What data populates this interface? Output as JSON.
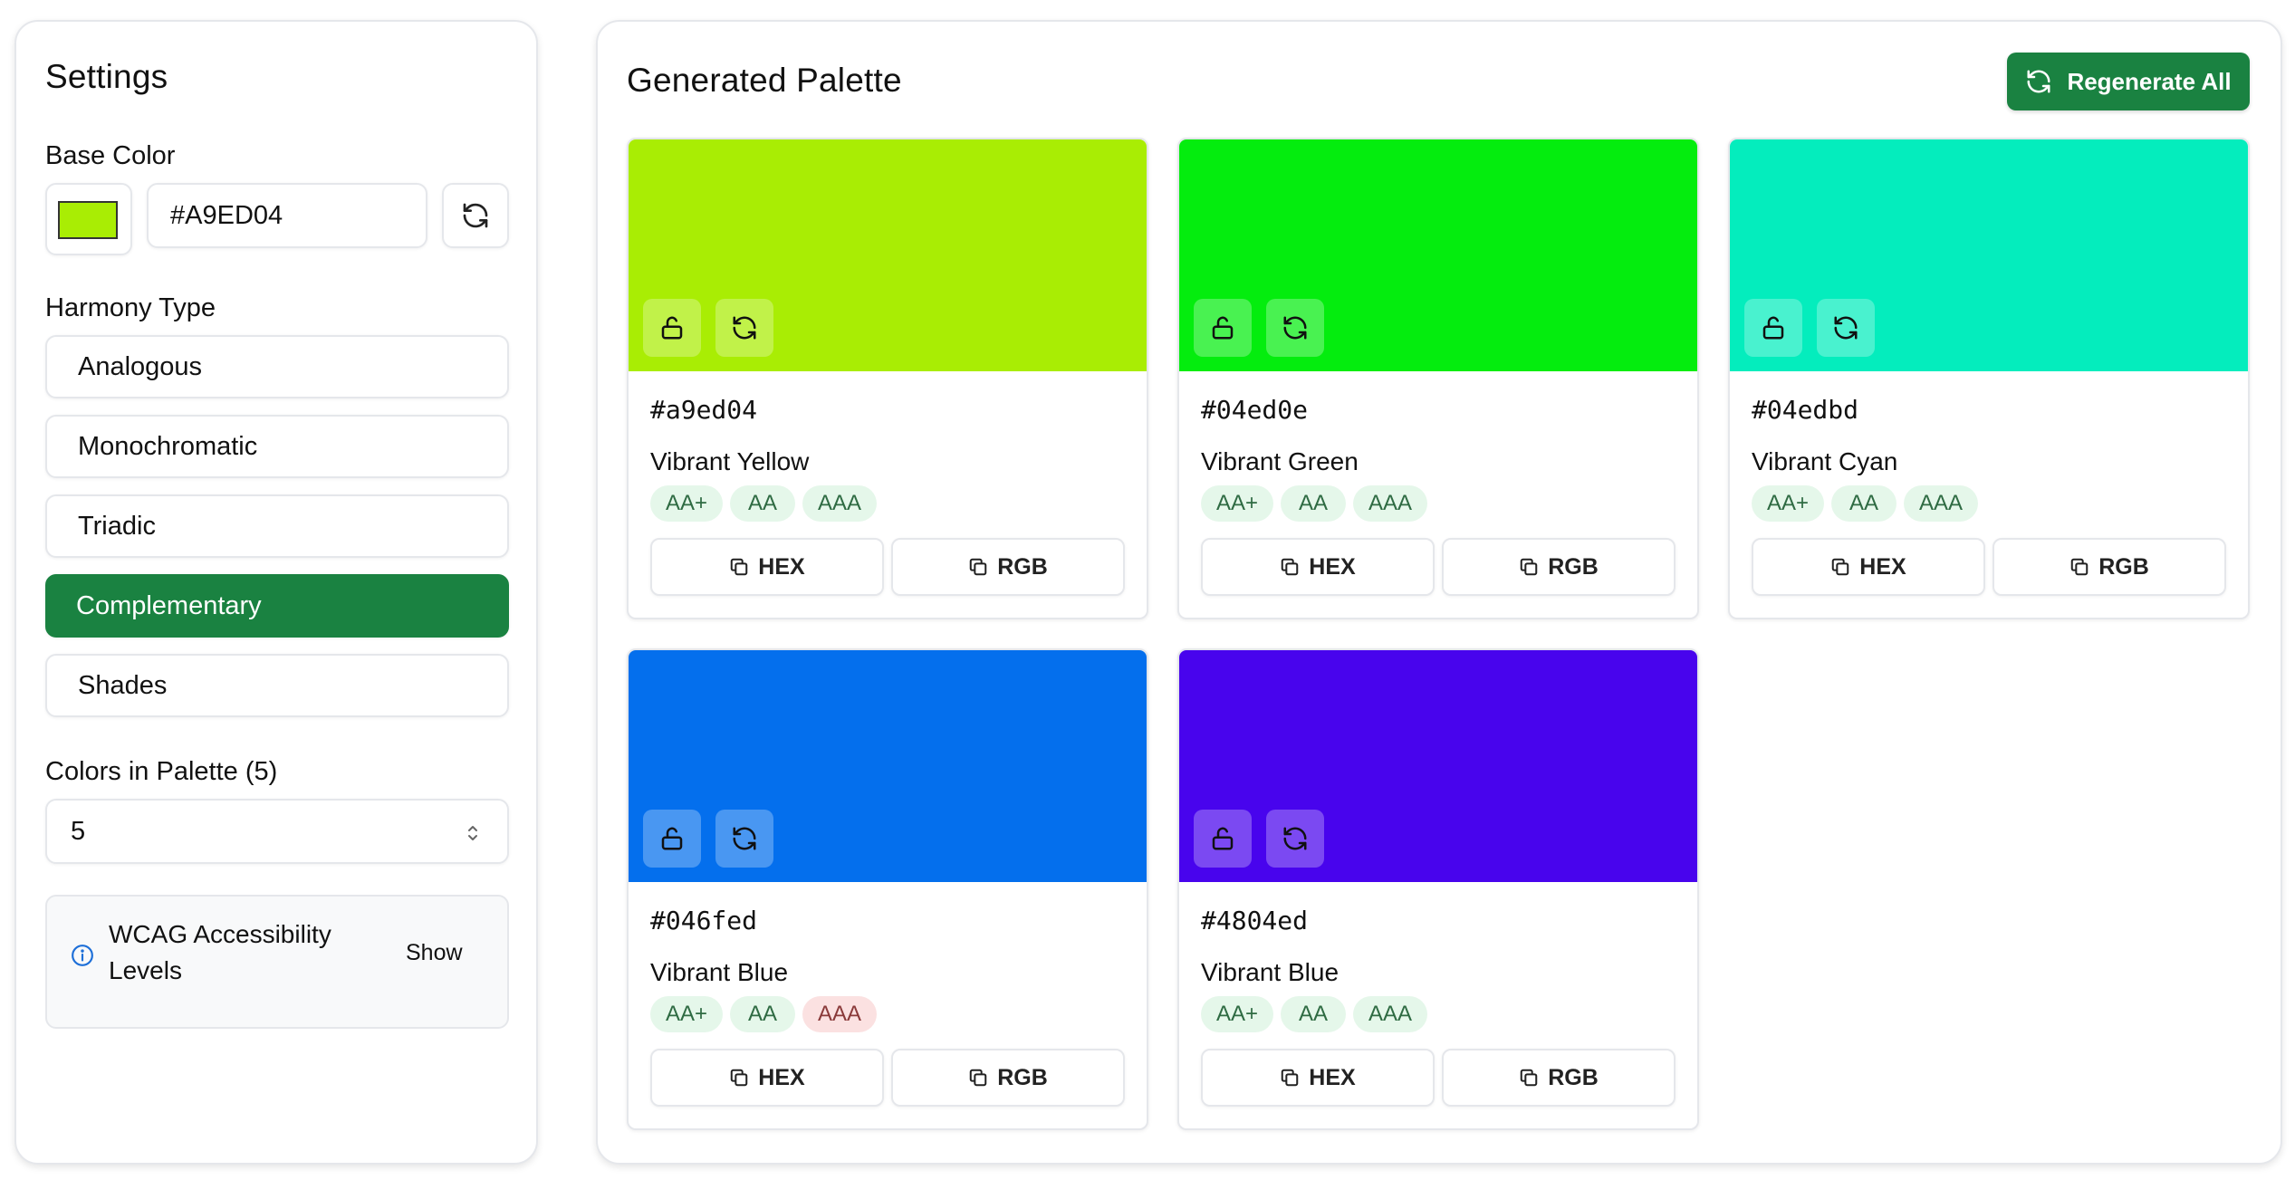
{
  "settings": {
    "title": "Settings",
    "base_color_label": "Base Color",
    "base_color_value": "#A9ED04",
    "harmony_label": "Harmony Type",
    "harmony_options": [
      "Analogous",
      "Monochromatic",
      "Triadic",
      "Complementary",
      "Shades"
    ],
    "harmony_selected": "Complementary",
    "count_label": "Colors in Palette (5)",
    "count_value": "5",
    "wcag_label": "WCAG Accessibility Levels",
    "wcag_toggle": "Show"
  },
  "palette": {
    "title": "Generated Palette",
    "regenerate_label": "Regenerate All",
    "hex_button": "HEX",
    "rgb_button": "RGB",
    "cards": [
      {
        "hex": "#a9ed04",
        "name": "Vibrant Yellow",
        "color": "#a9ed04",
        "badges": [
          {
            "label": "AA+",
            "pass": true
          },
          {
            "label": "AA",
            "pass": true
          },
          {
            "label": "AAA",
            "pass": true
          }
        ]
      },
      {
        "hex": "#04ed0e",
        "name": "Vibrant Green",
        "color": "#04ed0e",
        "badges": [
          {
            "label": "AA+",
            "pass": true
          },
          {
            "label": "AA",
            "pass": true
          },
          {
            "label": "AAA",
            "pass": true
          }
        ]
      },
      {
        "hex": "#04edbd",
        "name": "Vibrant Cyan",
        "color": "#04edbd",
        "badges": [
          {
            "label": "AA+",
            "pass": true
          },
          {
            "label": "AA",
            "pass": true
          },
          {
            "label": "AAA",
            "pass": true
          }
        ]
      },
      {
        "hex": "#046fed",
        "name": "Vibrant Blue",
        "color": "#046fed",
        "badges": [
          {
            "label": "AA+",
            "pass": true
          },
          {
            "label": "AA",
            "pass": true
          },
          {
            "label": "AAA",
            "pass": false
          }
        ]
      },
      {
        "hex": "#4804ed",
        "name": "Vibrant Blue",
        "color": "#4804ed",
        "badges": [
          {
            "label": "AA+",
            "pass": true
          },
          {
            "label": "AA",
            "pass": true
          },
          {
            "label": "AAA",
            "pass": true
          }
        ]
      }
    ]
  },
  "icons": {
    "refresh": "refresh-icon",
    "lock": "unlock-icon",
    "copy": "copy-icon",
    "info": "info-icon",
    "stepper": "chevron-updown-icon"
  },
  "colors": {
    "accent": "#1a8241",
    "border": "#e5e7eb",
    "badge_pass_bg": "#e5f7ea",
    "badge_fail_bg": "#fbe1e1"
  }
}
